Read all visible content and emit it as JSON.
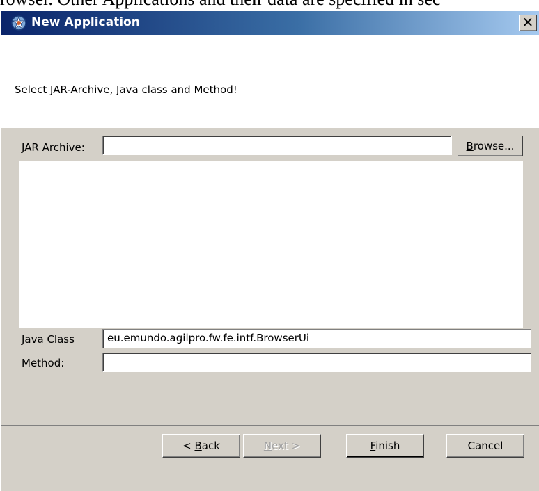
{
  "document": {
    "caption_fragment": "rowser. Other Applications and their data are specified in sec"
  },
  "window": {
    "title": "New Application",
    "close_glyph": "✕"
  },
  "banner": {
    "message": "Select JAR-Archive, Java class and Method!"
  },
  "form": {
    "jar_label": "JAR Archive:",
    "jar_value": "",
    "browse": {
      "prefix": "",
      "accel": "B",
      "suffix": "rowse..."
    },
    "java_class_label": "Java Class",
    "java_class_value": "eu.emundo.agilpro.fw.fe.intf.BrowserUi",
    "method_label": "Method:",
    "method_value": ""
  },
  "footer": {
    "back": {
      "prefix": "< ",
      "accel": "B",
      "suffix": "ack"
    },
    "next": {
      "prefix": "",
      "accel": "N",
      "suffix": "ext >"
    },
    "finish": {
      "prefix": "",
      "accel": "F",
      "suffix": "inish"
    },
    "cancel": "Cancel"
  },
  "colors": {
    "window_face": "#d4d0c8",
    "titlebar_start": "#0a246a",
    "titlebar_end": "#a6caf0",
    "disabled_text": "#a0a0a0"
  },
  "icons": {
    "app": "application-gear-icon",
    "close": "close-icon"
  }
}
